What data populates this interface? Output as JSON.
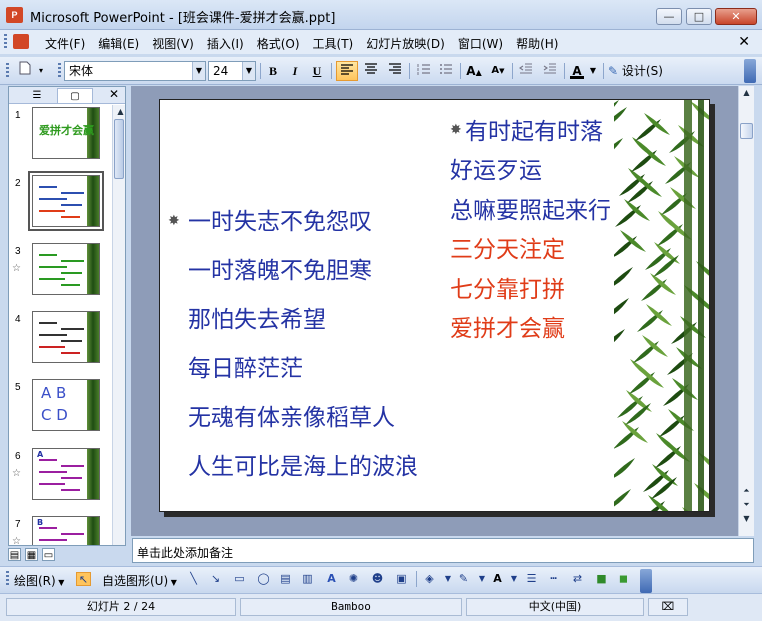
{
  "window": {
    "title": "Microsoft PowerPoint - [班会课件-爱拼才会赢.ppt]",
    "app_icon_text": "P",
    "minimize": "—",
    "maximize": "□",
    "close": "✕"
  },
  "menu": {
    "items": [
      "文件(F)",
      "编辑(E)",
      "视图(V)",
      "插入(I)",
      "格式(O)",
      "工具(T)",
      "幻灯片放映(D)",
      "窗口(W)",
      "帮助(H)"
    ],
    "close": "✕"
  },
  "toolbar": {
    "font_name": "宋体",
    "font_size": "24",
    "bold": "B",
    "italic": "I",
    "underline": "U",
    "design_label": "设计(S)",
    "font_color_label": "A"
  },
  "panel": {
    "tab_outline": "☰",
    "tab_slides": "▢",
    "close": "✕",
    "thumbnails": [
      {
        "num": "1",
        "title": "爱拼才会赢",
        "star": ""
      },
      {
        "num": "2",
        "title": "",
        "star": ""
      },
      {
        "num": "3",
        "title": "",
        "star": "☆"
      },
      {
        "num": "4",
        "title": "",
        "star": ""
      },
      {
        "num": "5",
        "title": "A B C D",
        "star": ""
      },
      {
        "num": "6",
        "title": "A",
        "star": "☆"
      },
      {
        "num": "7",
        "title": "B",
        "star": "☆"
      }
    ]
  },
  "slide": {
    "left_bullet": "✸",
    "right_bullet": "✸",
    "left_lines": [
      "一时失志不免怨叹",
      "一时落魄不免胆寒",
      "那怕失去希望",
      "每日醉茫茫",
      "无魂有体亲像稻草人",
      "人生可比是海上的波浪"
    ],
    "right_lines_blue": [
      "有时起有时落",
      "好运歹运",
      "总嘛要照起来行"
    ],
    "right_lines_red": [
      "三分天注定",
      "七分靠打拼",
      "爱拼才会赢"
    ],
    "colors": {
      "blue": "#2433a4",
      "red": "#e03c18"
    }
  },
  "notes": {
    "placeholder": "单击此处添加备注"
  },
  "drawbar": {
    "draw_label": "绘图(R)",
    "autoshape_label": "自选图形(U)"
  },
  "status": {
    "slide_info": "幻灯片 2 / 24",
    "design": "Bamboo",
    "language": "中文(中国)"
  }
}
